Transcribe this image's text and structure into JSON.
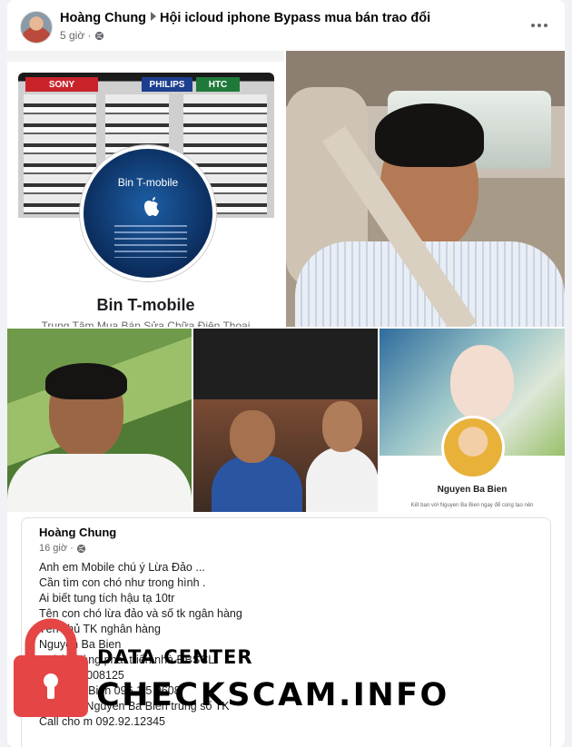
{
  "post": {
    "author": "Hoàng Chung",
    "group": "Hội icloud iphone Bypass mua bán trao đổi",
    "time": "5 giờ ·"
  },
  "photos": {
    "shop": {
      "signs": [
        "SONY",
        "PHILIPS",
        "HTC"
      ],
      "badge_title": "Bin T-mobile",
      "name": "Bin T-mobile",
      "subtitle": "Trung Tâm Mua Bán Sửa Chữa Điện Thoại"
    },
    "profile": {
      "name": "Nguyen Ba Bien",
      "caption": "Kết bạn với Nguyen Ba Bien ngay để cùng tạo nên"
    }
  },
  "shared_post": {
    "author": "Hoàng Chung",
    "time": "16 giờ ·",
    "lines": [
      "Anh em Mobile chú ý Lừa Đảo ...",
      "Cần tìm con chó như trong hình .",
      "Ai biết tung tích hậu tạ 10tr",
      "Tên con chó lừa đảo và số tk ngân hàng",
      "Tên chủ TK nghân hàng",
      "Nguyen Ba Bien",
      "Nghân hàng phát triển nhà ĐBSCL",
      "0470 1 0 008125",
      "Nick zalo Bien 096 1 5 9608",
      "Tên zalo Nguyen Ba Bien trùng số TK",
      "Call cho m 092.92.12345"
    ]
  },
  "watermark": {
    "line1": "DATA CENTER",
    "line2": "CHECKSCAM.INFO",
    "lock_color": "#e64545"
  }
}
